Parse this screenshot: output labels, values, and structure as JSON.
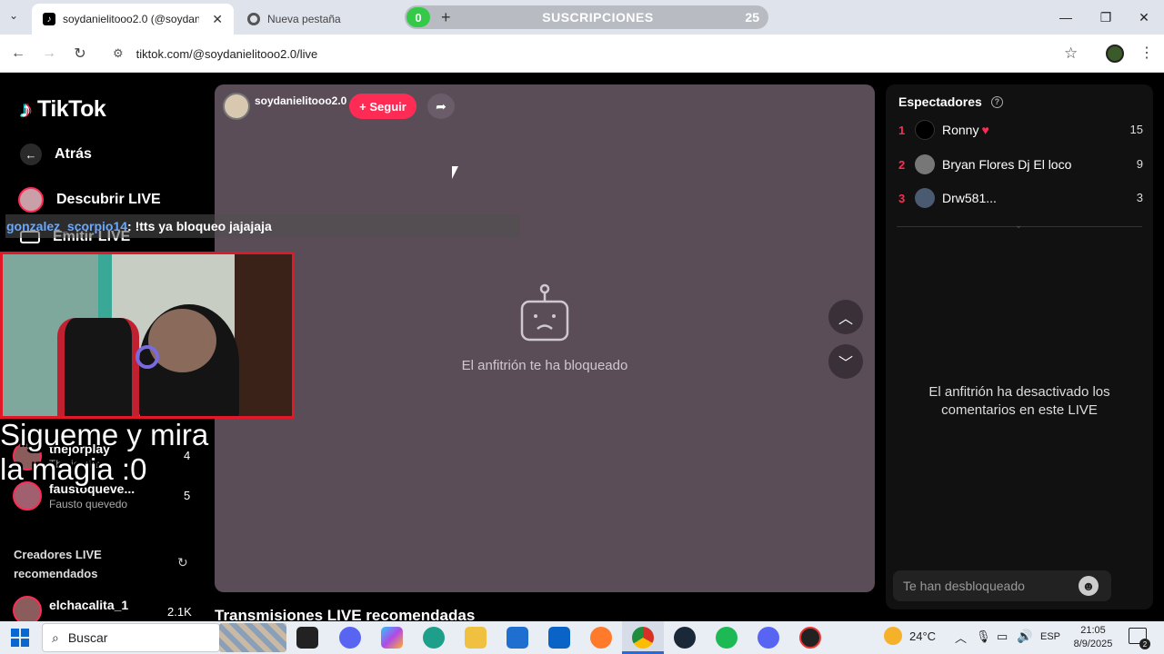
{
  "browser": {
    "tabs": [
      {
        "title": "soydanielitooo2.0 (@soydanielit",
        "active": true
      },
      {
        "title": "Nueva pestaña",
        "active": false
      }
    ],
    "subscriptions": {
      "badge": "0",
      "label": "SUSCRIPCIONES",
      "count": "25"
    },
    "url": "tiktok.com/@soydanielitooo2.0/live"
  },
  "sidebar": {
    "logo": "TikTok",
    "back": "Atrás",
    "discover": "Descubrir LIVE",
    "emit": "Emitir LIVE",
    "following": [
      {
        "name": "thejorplay",
        "sub": "The jorplay",
        "count": "4"
      },
      {
        "name": "faustoqueve...",
        "sub": "Fausto quevedo",
        "count": "5"
      }
    ],
    "recommended_title": "Creadores LIVE recomendados",
    "recommended": [
      {
        "name": "elchacalita_1",
        "count": "2.1K"
      }
    ]
  },
  "overlay": {
    "chat_user": "gonzalez_scorpio14",
    "chat_msg": " : !tts ya bloqueo jajajaja",
    "caption": "Sigueme y mira la magia :0"
  },
  "stream": {
    "host": "soydanielitooo2.0",
    "follow": "+ Seguir",
    "blocked_msg": "El anfitrión te ha bloqueado",
    "below_title": "Transmisiones LIVE recomendadas"
  },
  "viewers": {
    "title": "Espectadores",
    "list": [
      {
        "rank": "1",
        "name": "Ronny",
        "score": "15"
      },
      {
        "rank": "2",
        "name": "Bryan Flores Dj El loco",
        "score": "9"
      },
      {
        "rank": "3",
        "name": "Drw581...",
        "score": "3"
      }
    ],
    "comments_disabled": "El anfitrión ha desactivado los comentarios en este LIVE",
    "input_placeholder": "Te han desbloqueado"
  },
  "taskbar": {
    "search": "Buscar",
    "weather": "24°C",
    "lang": "ESP",
    "time": "21:05",
    "date": "8/9/2025",
    "notif": "2"
  },
  "colors": {
    "accent": "#fe2c55",
    "stage": "#5a4d58"
  }
}
